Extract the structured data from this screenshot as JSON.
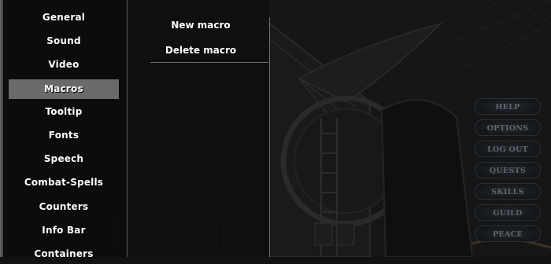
{
  "sidebar": {
    "items": [
      {
        "label": "General"
      },
      {
        "label": "Sound"
      },
      {
        "label": "Video"
      },
      {
        "label": "Macros",
        "active": true
      },
      {
        "label": "Tooltip"
      },
      {
        "label": "Fonts"
      },
      {
        "label": "Speech"
      },
      {
        "label": "Combat-Spells"
      },
      {
        "label": "Counters"
      },
      {
        "label": "Info Bar"
      },
      {
        "label": "Containers"
      }
    ]
  },
  "macros_panel": {
    "new_macro_label": "New macro",
    "delete_macro_label": "Delete macro"
  },
  "game_menu": {
    "buttons": [
      {
        "label": "HELP"
      },
      {
        "label": "OPTIONS"
      },
      {
        "label": "LOG OUT"
      },
      {
        "label": "QUESTS"
      },
      {
        "label": "SKILLS"
      },
      {
        "label": "GUILD"
      },
      {
        "label": "PEACE"
      }
    ]
  },
  "colors": {
    "active_item_bg": "#6a6a6a",
    "menu_text": "#ffffff",
    "game_button_text": "#5c6770",
    "panel_bg": "#121212"
  },
  "icons": [
    "background-game-art",
    "paperdoll-slot-icons"
  ]
}
